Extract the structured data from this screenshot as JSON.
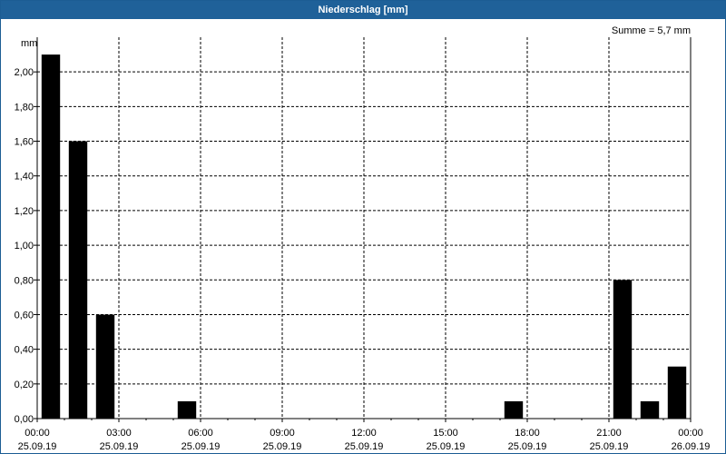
{
  "window": {
    "title": "Niederschlag [mm]"
  },
  "colors": {
    "titlebar": "#1f6199",
    "bar": "#000000",
    "grid": "#000000"
  },
  "chart_data": {
    "type": "bar",
    "title": "Niederschlag [mm]",
    "ylabel": "mm",
    "summary": "Summe = 5,7 mm",
    "ylim": [
      0,
      2.2
    ],
    "yticks": [
      {
        "value": 0.0,
        "label": "0,00"
      },
      {
        "value": 0.2,
        "label": "0,20"
      },
      {
        "value": 0.4,
        "label": "0,40"
      },
      {
        "value": 0.6,
        "label": "0,60"
      },
      {
        "value": 0.8,
        "label": "0,80"
      },
      {
        "value": 1.0,
        "label": "1,00"
      },
      {
        "value": 1.2,
        "label": "1,20"
      },
      {
        "value": 1.4,
        "label": "1,40"
      },
      {
        "value": 1.6,
        "label": "1,60"
      },
      {
        "value": 1.8,
        "label": "1,80"
      },
      {
        "value": 2.0,
        "label": "2,00"
      }
    ],
    "xticks": [
      {
        "hour": 0,
        "time": "00:00",
        "date": "25.09.19"
      },
      {
        "hour": 3,
        "time": "03:00",
        "date": "25.09.19"
      },
      {
        "hour": 6,
        "time": "06:00",
        "date": "25.09.19"
      },
      {
        "hour": 9,
        "time": "09:00",
        "date": "25.09.19"
      },
      {
        "hour": 12,
        "time": "12:00",
        "date": "25.09.19"
      },
      {
        "hour": 15,
        "time": "15:00",
        "date": "25.09.19"
      },
      {
        "hour": 18,
        "time": "18:00",
        "date": "25.09.19"
      },
      {
        "hour": 21,
        "time": "21:00",
        "date": "25.09.19"
      },
      {
        "hour": 24,
        "time": "00:00",
        "date": "26.09.19"
      }
    ],
    "x_range_hours": [
      0,
      24
    ],
    "grid": true,
    "hourly_values": [
      2.1,
      1.6,
      0.6,
      0.0,
      0.0,
      0.1,
      0.0,
      0.0,
      0.0,
      0.0,
      0.0,
      0.0,
      0.0,
      0.0,
      0.0,
      0.0,
      0.0,
      0.1,
      0.0,
      0.0,
      0.0,
      0.8,
      0.1,
      0.3
    ]
  }
}
